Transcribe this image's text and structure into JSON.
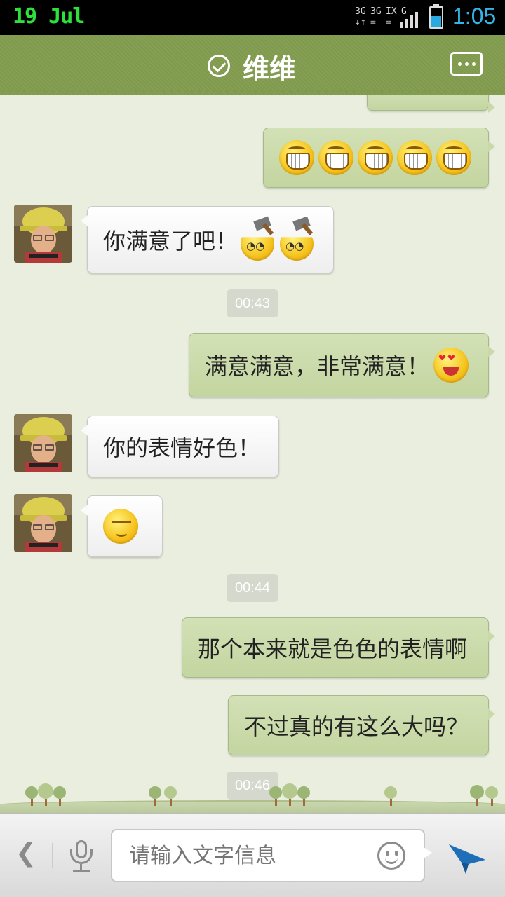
{
  "status_bar": {
    "date": "19 Jul",
    "network_top": [
      "3G",
      "3G",
      "IX",
      "G"
    ],
    "time": "1:05",
    "battery_level": 0.55
  },
  "header": {
    "title": "维维",
    "accent_color": "#7f9a4c"
  },
  "messages": [
    {
      "type": "sent",
      "content": "grin-emoji-x5"
    },
    {
      "type": "received",
      "text": "你满意了吧！",
      "emoji": "axe-emoji-x2"
    },
    {
      "type": "time",
      "text": "00:43"
    },
    {
      "type": "sent",
      "text": "满意满意，非常满意！",
      "emoji": "heart-eyes-emoji"
    },
    {
      "type": "received",
      "text": "你的表情好色！"
    },
    {
      "type": "received",
      "emoji": "smirk-emoji"
    },
    {
      "type": "time",
      "text": "00:44"
    },
    {
      "type": "sent",
      "text": "那个本来就是色色的表情啊"
    },
    {
      "type": "sent",
      "text": "不过真的有这么大吗？"
    },
    {
      "type": "time",
      "text": "00:46"
    }
  ],
  "input_bar": {
    "placeholder": "请输入文字信息",
    "icons": [
      "back-chevron-icon",
      "microphone-icon",
      "smiley-icon",
      "send-plane-icon"
    ]
  }
}
